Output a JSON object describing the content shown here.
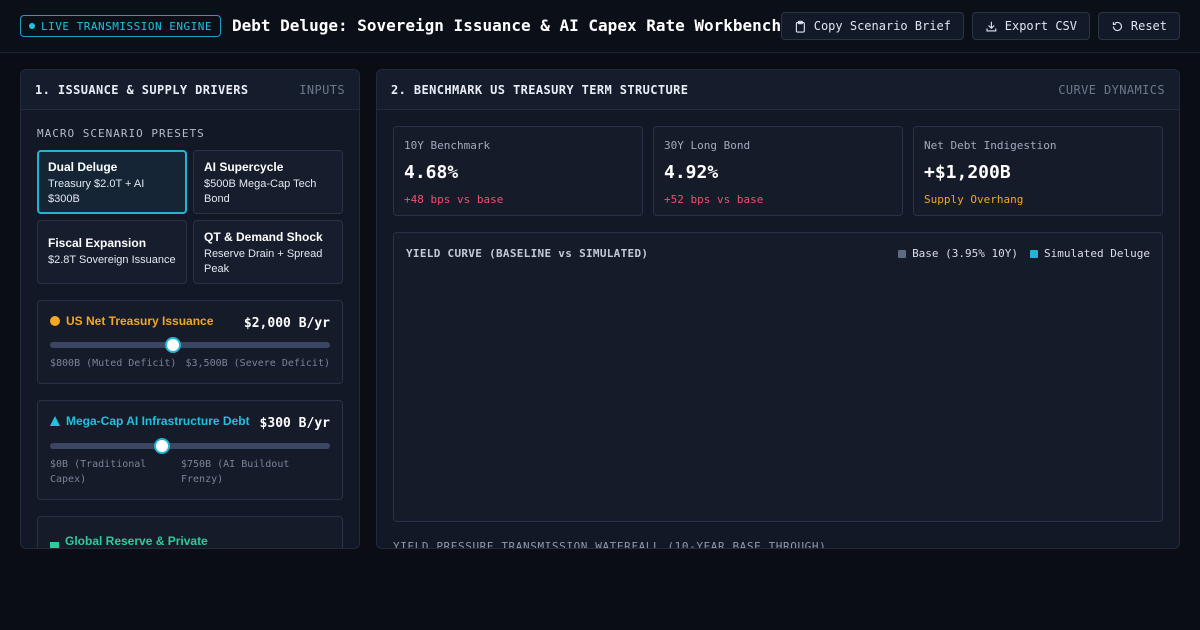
{
  "header": {
    "badge": "LIVE TRANSMISSION ENGINE",
    "title": "Debt Deluge: Sovereign Issuance & AI Capex Rate Workbench",
    "buttons": {
      "copy": "Copy Scenario Brief",
      "export": "Export CSV",
      "reset": "Reset"
    },
    "icons": [
      "clipboard-icon",
      "download-icon",
      "reset-icon"
    ]
  },
  "left_panel": {
    "title": "1. ISSUANCE & SUPPLY DRIVERS",
    "tag": "INPUTS",
    "presets_label": "MACRO SCENARIO PRESETS",
    "presets": [
      {
        "name": "Dual Deluge",
        "desc": "Treasury $2.0T + AI $300B",
        "active": true
      },
      {
        "name": "AI Supercycle",
        "desc": "$500B Mega-Cap Tech Bond",
        "active": false
      },
      {
        "name": "Fiscal Expansion",
        "desc": "$2.8T Sovereign Issuance",
        "active": false
      },
      {
        "name": "QT & Demand Shock",
        "desc": "Reserve Drain + Spread Peak",
        "active": false
      }
    ],
    "controls": [
      {
        "label": "US Net Treasury Issuance",
        "value": "$2,000 B/yr",
        "min_label": "$800B (Muted Deficit)",
        "max_label": "$3,500B (Severe Deficit)",
        "position": 0.44,
        "color": "#f5a623",
        "icon": "circle-icon"
      },
      {
        "label": "Mega-Cap AI Infrastructure Debt",
        "value": "$300 B/yr",
        "min_label": "$0B (Traditional Capex)",
        "max_label": "$750B (AI Buildout Frenzy)",
        "position": 0.4,
        "color": "#22c1e0",
        "icon": "triangle-icon"
      },
      {
        "label": "Global Reserve & Private",
        "color": "#2ecc9a",
        "icon": "square-icon"
      }
    ]
  },
  "right_panel": {
    "title": "2. BENCHMARK US TREASURY TERM STRUCTURE",
    "tag": "CURVE DYNAMICS",
    "stats": [
      {
        "label": "10Y Benchmark",
        "value": "4.68%",
        "delta": "+48 bps vs base",
        "delta_color": "#f0506e"
      },
      {
        "label": "30Y Long Bond",
        "value": "4.92%",
        "delta": "+52 bps vs base",
        "delta_color": "#f0506e"
      },
      {
        "label": "Net Debt Indigestion",
        "value": "+$1,200B",
        "delta": "Supply Overhang",
        "delta_color": "#f5a623"
      }
    ],
    "chart": {
      "title": "YIELD CURVE (BASELINE vs SIMULATED)",
      "legend": [
        {
          "name": "Base (3.95% 10Y)",
          "color": "#5d6a82"
        },
        {
          "name": "Simulated Deluge",
          "color": "#1fb6d6"
        }
      ]
    },
    "below_chart": "YIELD PRESSURE TRANSMISSION WATERFALL (10-YEAR BASE THROUGH)"
  }
}
